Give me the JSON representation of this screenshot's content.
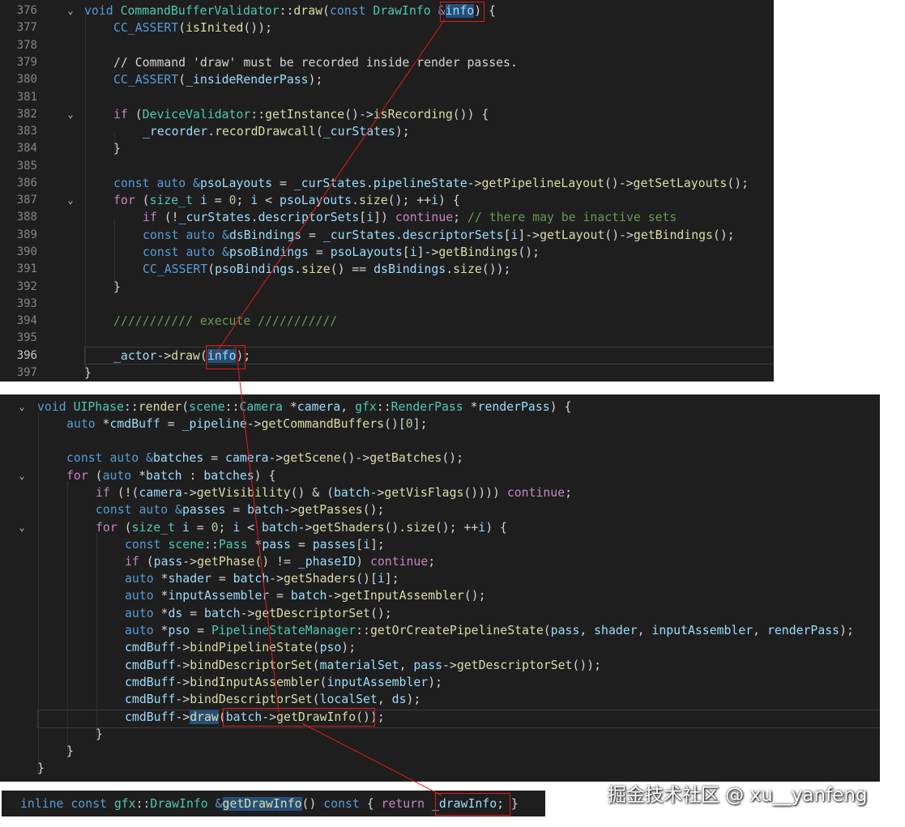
{
  "panel_top": {
    "lines": [
      {
        "num": "376",
        "text": "void CommandBufferValidator::draw(const DrawInfo &info) {"
      },
      {
        "num": "377",
        "text": "CC_ASSERT(isInited());"
      },
      {
        "num": "378",
        "text": ""
      },
      {
        "num": "379",
        "text": "// Command 'draw' must be recorded inside render passes."
      },
      {
        "num": "380",
        "text": "CC_ASSERT(_insideRenderPass);"
      },
      {
        "num": "381",
        "text": ""
      },
      {
        "num": "382",
        "text": "if (DeviceValidator::getInstance()->isRecording()) {"
      },
      {
        "num": "383",
        "text": "_recorder.recordDrawcall(_curStates);"
      },
      {
        "num": "384",
        "text": "}"
      },
      {
        "num": "385",
        "text": ""
      },
      {
        "num": "386",
        "text": "const auto &psoLayouts = _curStates.pipelineState->getPipelineLayout()->getSetLayouts();"
      },
      {
        "num": "387",
        "text": "for (size_t i = 0; i < psoLayouts.size(); ++i) {"
      },
      {
        "num": "388",
        "text": "if (!_curStates.descriptorSets[i]) continue; // there may be inactive sets"
      },
      {
        "num": "389",
        "text": "const auto &dsBindings = _curStates.descriptorSets[i]->getLayout()->getBindings();"
      },
      {
        "num": "390",
        "text": "const auto &psoBindings = psoLayouts[i]->getBindings();"
      },
      {
        "num": "391",
        "text": "CC_ASSERT(psoBindings.size() == dsBindings.size());"
      },
      {
        "num": "392",
        "text": "}"
      },
      {
        "num": "393",
        "text": ""
      },
      {
        "num": "394",
        "text": "/////////// execute ///////////"
      },
      {
        "num": "395",
        "text": ""
      },
      {
        "num": "396",
        "text": "_actor->draw(info);"
      },
      {
        "num": "397",
        "text": "}"
      }
    ]
  },
  "panel_middle": {
    "lines": [
      {
        "text": "void UIPhase::render(scene::Camera *camera, gfx::RenderPass *renderPass) {"
      },
      {
        "text": "auto *cmdBuff = _pipeline->getCommandBuffers()[0];"
      },
      {
        "text": ""
      },
      {
        "text": "const auto &batches = camera->getScene()->getBatches();"
      },
      {
        "text": "for (auto *batch : batches) {"
      },
      {
        "text": "if (!(camera->getVisibility() & (batch->getVisFlags()))) continue;"
      },
      {
        "text": "const auto &passes = batch->getPasses();"
      },
      {
        "text": "for (size_t i = 0; i < batch->getShaders().size(); ++i) {"
      },
      {
        "text": "const scene::Pass *pass = passes[i];"
      },
      {
        "text": "if (pass->getPhase() != _phaseID) continue;"
      },
      {
        "text": "auto *shader = batch->getShaders()[i];"
      },
      {
        "text": "auto *inputAssembler = batch->getInputAssembler();"
      },
      {
        "text": "auto *ds = batch->getDescriptorSet();"
      },
      {
        "text": "auto *pso = PipelineStateManager::getOrCreatePipelineState(pass, shader, inputAssembler, renderPass);"
      },
      {
        "text": "cmdBuff->bindPipelineState(pso);"
      },
      {
        "text": "cmdBuff->bindDescriptorSet(materialSet, pass->getDescriptorSet());"
      },
      {
        "text": "cmdBuff->bindInputAssembler(inputAssembler);"
      },
      {
        "text": "cmdBuff->bindDescriptorSet(localSet, ds);"
      },
      {
        "text": "cmdBuff->draw(batch->getDrawInfo());"
      },
      {
        "text": "}"
      },
      {
        "text": "}"
      },
      {
        "text": "}"
      }
    ]
  },
  "panel_bottom": {
    "text": "inline const gfx::DrawInfo &getDrawInfo() const { return _drawInfo; }"
  },
  "watermark": "掘金技术社区 @ xu__yanfeng",
  "colors": {
    "editor_bg": "#1e1e1e",
    "keyword": "#569cd6",
    "control": "#c586c0",
    "type": "#4ec9b0",
    "function": "#dcdcaa",
    "variable": "#9cdcfe",
    "comment": "#6a9955",
    "highlight": "#264f78",
    "annotation": "#e11a1a"
  }
}
